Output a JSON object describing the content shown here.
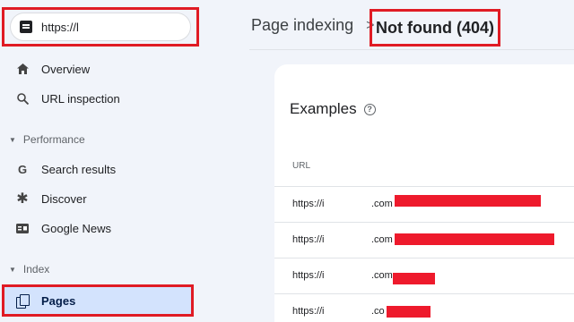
{
  "property": {
    "url": "https://l",
    "icon": "property-icon"
  },
  "sidebar": {
    "items": [
      {
        "label": "Overview",
        "icon": "home-icon"
      },
      {
        "label": "URL inspection",
        "icon": "search-icon"
      }
    ],
    "performance": {
      "label": "Performance",
      "items": [
        {
          "label": "Search results",
          "icon": "google-g-icon"
        },
        {
          "label": "Discover",
          "icon": "asterisk-icon"
        },
        {
          "label": "Google News",
          "icon": "news-icon"
        }
      ]
    },
    "index": {
      "label": "Index",
      "items": [
        {
          "label": "Pages",
          "icon": "pages-icon"
        }
      ]
    }
  },
  "header": {
    "parent": "Page indexing",
    "separator": ">",
    "current": "Not found (404)"
  },
  "examples": {
    "title": "Examples",
    "column": "URL",
    "rows": [
      {
        "prefix": "https://i",
        "suffix": ".com"
      },
      {
        "prefix": "https://i",
        "suffix": ".com"
      },
      {
        "prefix": "https://i",
        "suffix": ".com"
      },
      {
        "prefix": "https://i",
        "suffix": ".co"
      }
    ]
  },
  "colors": {
    "highlight": "#e01b24",
    "redaction": "#ee1a2c",
    "selected": "#d3e3fd"
  }
}
